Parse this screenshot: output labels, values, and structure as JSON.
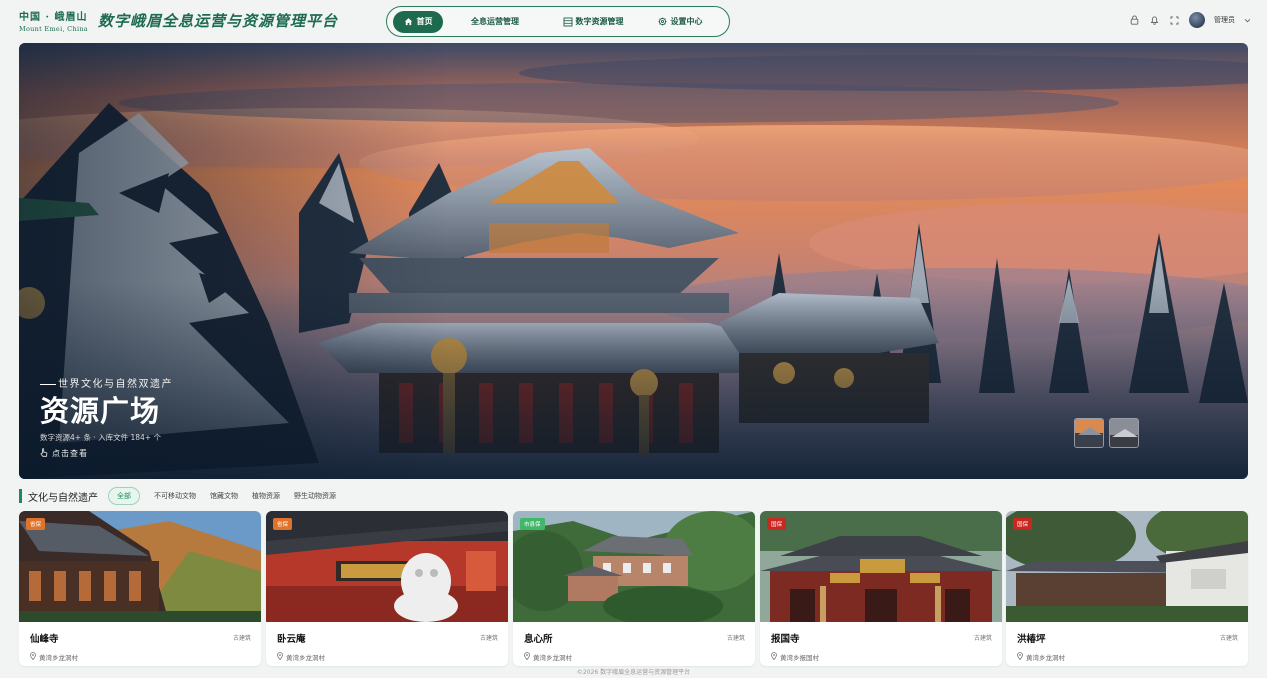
{
  "header": {
    "brand_cn": "中国 · 峨眉山",
    "brand_en": "Mount Emei, China",
    "platform_title": "数字峨眉全息运营与资源管理平台",
    "nav": [
      {
        "label": "首页",
        "icon": "home-icon",
        "active": true
      },
      {
        "label": "全息运营管理",
        "icon": "",
        "active": false
      },
      {
        "label": "数字资源管理",
        "icon": "database-icon",
        "active": false
      },
      {
        "label": "设置中心",
        "icon": "gear-icon",
        "active": false
      }
    ],
    "icons": [
      "lock-icon",
      "bell-icon",
      "fullscreen-icon"
    ],
    "user": "管理员"
  },
  "hero": {
    "subtitle": "世界文化与自然双遗产",
    "title": "资源广场",
    "stats": "数字资源4+ 条 · 入库文件 184+ 个",
    "cta": "点击查看"
  },
  "filter": {
    "section_title": "文化与自然遗产",
    "tabs": [
      "全部",
      "不可移动文物",
      "馆藏文物",
      "植物资源",
      "野生动物资源"
    ],
    "active_tab": "全部"
  },
  "cards": [
    {
      "name": "仙峰寺",
      "type": "古建筑",
      "badge": "省保",
      "badge_color": "#e0732a",
      "location": "黄湾乡龙洞村"
    },
    {
      "name": "卧云庵",
      "type": "古建筑",
      "badge": "省保",
      "badge_color": "#e0732a",
      "location": "黄湾乡龙洞村"
    },
    {
      "name": "息心所",
      "type": "古建筑",
      "badge": "市县保",
      "badge_color": "#3fb86a",
      "location": "黄湾乡龙洞村"
    },
    {
      "name": "报国寺",
      "type": "古建筑",
      "badge": "国保",
      "badge_color": "#c8281f",
      "location": "黄湾乡报国村"
    },
    {
      "name": "洪椿坪",
      "type": "古建筑",
      "badge": "国保",
      "badge_color": "#c8281f",
      "location": "黄湾乡龙洞村"
    }
  ],
  "footer": "©2026 数字峨眉全息运营与资源管理平台"
}
